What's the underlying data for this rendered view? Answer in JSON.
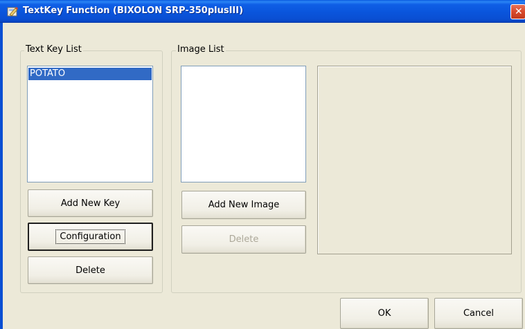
{
  "window": {
    "title": "TextKey Function (BIXOLON SRP-350plusIII)",
    "close_glyph": "✕"
  },
  "text_key_group": {
    "title": "Text Key List",
    "items": [
      "POTATO"
    ],
    "selected_index": 0,
    "add_button": "Add New Key",
    "config_button": "Configuration",
    "delete_button": "Delete"
  },
  "image_group": {
    "title": "Image List",
    "items": [],
    "add_button": "Add New Image",
    "delete_button": "Delete"
  },
  "footer": {
    "ok_button": "OK",
    "cancel_button": "Cancel"
  },
  "colors": {
    "titlebar": "#0a55dc",
    "dialog_bg": "#ece9d8",
    "selection": "#316ac5"
  }
}
